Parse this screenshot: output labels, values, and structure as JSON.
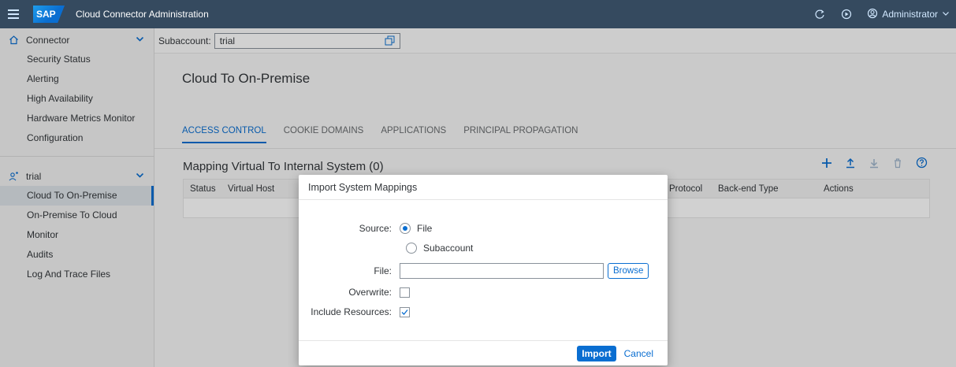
{
  "shell": {
    "logo": "SAP",
    "title": "Cloud Connector Administration",
    "user": "Administrator",
    "icons": [
      "refresh-icon",
      "play-icon",
      "user-icon",
      "chevron-down-icon"
    ]
  },
  "sidebar": {
    "connector_group": {
      "label": "Connector",
      "items": [
        "Security Status",
        "Alerting",
        "High Availability",
        "Hardware Metrics Monitor",
        "Configuration"
      ]
    },
    "subaccount_group": {
      "label": "trial",
      "items": [
        "Cloud To On-Premise",
        "On-Premise To Cloud",
        "Monitor",
        "Audits",
        "Log And Trace Files"
      ],
      "active_index": 0
    }
  },
  "subaccount_bar": {
    "label": "Subaccount:",
    "value": "trial"
  },
  "page": {
    "title": "Cloud To On-Premise",
    "tabs": [
      "ACCESS CONTROL",
      "COOKIE DOMAINS",
      "APPLICATIONS",
      "PRINCIPAL PROPAGATION"
    ],
    "active_tab": 0
  },
  "table": {
    "title": "Mapping Virtual To Internal System (0)",
    "columns": [
      "Status",
      "Virtual Host",
      "Protocol",
      "Back-end Type",
      "Actions"
    ]
  },
  "dialog": {
    "title": "Import System Mappings",
    "source_label": "Source:",
    "source_options": [
      "File",
      "Subaccount"
    ],
    "source_selected": "File",
    "file_label": "File:",
    "file_value": "",
    "browse_label": "Browse",
    "overwrite_label": "Overwrite:",
    "overwrite_checked": false,
    "include_label": "Include Resources:",
    "include_checked": true,
    "import_label": "Import",
    "cancel_label": "Cancel"
  },
  "colors": {
    "shell": "#354a5f",
    "accent": "#0a6ed1"
  }
}
